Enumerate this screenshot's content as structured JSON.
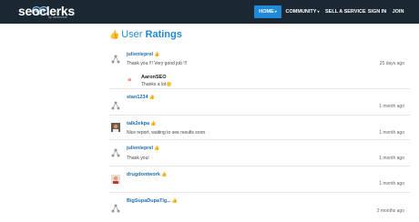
{
  "header": {
    "logo_text": "seoclerks",
    "logo_sub": "by dontcware",
    "nav": [
      {
        "label": "HOME",
        "caret": "▾"
      },
      {
        "label": "COMMUNITY",
        "caret": "▾"
      },
      {
        "label": "SELL A SERVICE"
      },
      {
        "label": "SIGN IN"
      },
      {
        "label": "JOIN"
      }
    ],
    "active_color": "#1f8ad6",
    "bg_color": "#1b2833"
  },
  "page": {
    "title_a": "User",
    "title_b": "Ratings",
    "thumb_icon": "thumbs-up-icon"
  },
  "reviews": [
    {
      "user": "julienleprel",
      "message": "Thank you !!! Very good job !!!",
      "time": "25 days ago",
      "reply": {
        "user": "AaronSEO",
        "message": "Thanks a lot"
      }
    },
    {
      "user": "stan1234",
      "message": "",
      "time": "1 month ago"
    },
    {
      "user": "talk2ekpa",
      "message": "Nice report, waiting to see results soon",
      "time": "1 month ago"
    },
    {
      "user": "julienleprel",
      "message": "Thank you!",
      "time": "1 month ago"
    },
    {
      "user": "drugdontwork",
      "message": "",
      "time": "1 month ago"
    },
    {
      "user": "BigSupaDupaTig...",
      "message": "",
      "time": "2 months ago"
    }
  ]
}
